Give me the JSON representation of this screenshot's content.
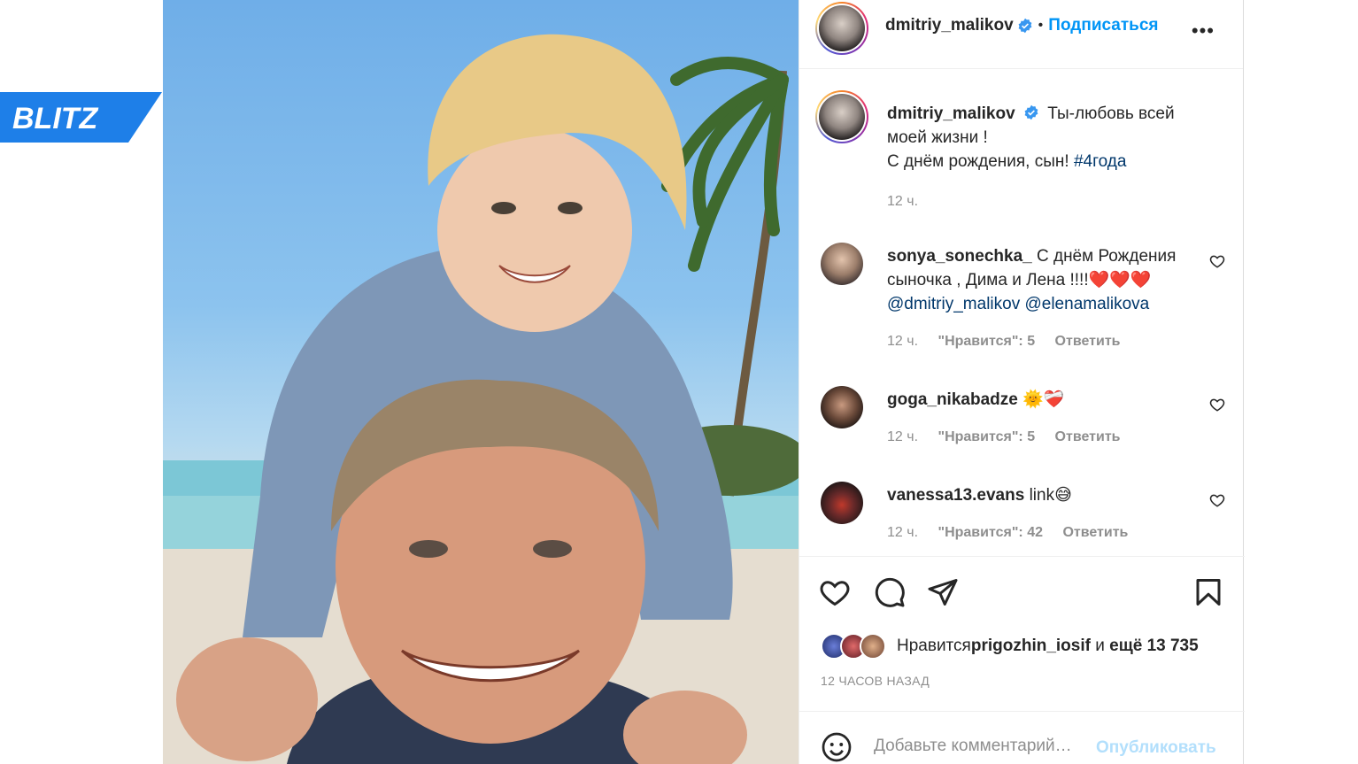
{
  "watermark": {
    "text": "BLITZ"
  },
  "post": {
    "author": "dmitriy_malikov",
    "separator": "•",
    "follow_label": "Подписаться",
    "more_label": "•••",
    "caption": {
      "username": "dmitriy_malikov",
      "line1": "Ты-любовь всей",
      "line2": "моей жизни !",
      "line3": "С днём рождения, сын! ",
      "hashtag": "#4года",
      "time": "12 ч."
    },
    "comments": [
      {
        "username": "sonya_sonechka_",
        "text1": " С днём Рождения",
        "text2": "сыночка , Дима и Лена !!!!",
        "emoji": "❤️❤️❤️",
        "mention1": "@dmitriy_malikov",
        "mention2": "@elenamalikova",
        "time": "12 ч.",
        "likes": "\"Нравится\": 5",
        "reply": "Ответить"
      },
      {
        "username": "goga_nikabadze",
        "emoji": "🌞❤️‍🩹",
        "time": "12 ч.",
        "likes": "\"Нравится\": 5",
        "reply": "Ответить"
      },
      {
        "username": "vanessa13.evans",
        "text1": " link",
        "emoji": "😅",
        "time": "12 ч.",
        "likes": "\"Нравится\": 42",
        "reply": "Ответить"
      }
    ],
    "likes": {
      "prefix": "Нравится ",
      "user": "prigozhin_iosif",
      "mid": " и ",
      "rest": "ещё 13 735"
    },
    "posted_ago": "12 ЧАСОВ НАЗАД",
    "add_comment_placeholder": "Добавьте комментарий…",
    "publish_label": "Опубликовать"
  },
  "colors": {
    "accent": "#0095f6",
    "link": "#00376b",
    "muted": "#8e8e8e",
    "watermark": "#1e7fe8"
  },
  "icons": [
    "heart-icon",
    "comment-icon",
    "share-icon",
    "bookmark-icon",
    "verified-icon",
    "emoji-icon",
    "more-icon"
  ]
}
